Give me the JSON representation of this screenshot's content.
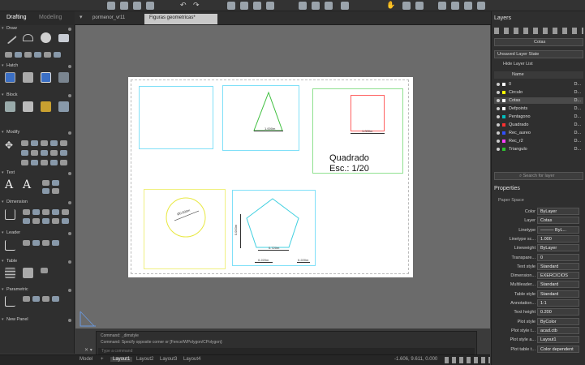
{
  "tabs": {
    "drafting": "Drafting",
    "modeling": "Modeling",
    "files": [
      "pormenor_vr11",
      "Figuras geometricas*"
    ]
  },
  "sections": [
    "Draw",
    "Hatch",
    "Block",
    "Modify",
    "Text",
    "Dimension",
    "Leader",
    "Table",
    "Parametric",
    "New Panel"
  ],
  "drawing": {
    "label1": "1.000m",
    "label2": "1.000m",
    "circle_label": "Ø0.600m",
    "pent_h": "0.000m",
    "pent_w1": "0.720m",
    "pent_w2": "0.220m",
    "pent_w3": "0.220m",
    "text_line1": "Quadrado",
    "text_line2": "Esc.: 1/20"
  },
  "command": {
    "line1": "Command: _dimstyle",
    "line2": "Command: Specify opposite corner or [Fence/WPolygon/CPolygon]:",
    "placeholder": "Type a command"
  },
  "status": {
    "model": "Model",
    "layouts": [
      "Layout1",
      "Layout2",
      "Layout3",
      "Layout4"
    ],
    "coords": "-1.606, 9.611, 0.000"
  },
  "layers": {
    "title": "Layers",
    "current": "Cotas",
    "state": "Unsaved Layer State",
    "hide_list": "Hide Layer List",
    "name_header": "Name",
    "rows": [
      {
        "name": "0",
        "color": "#ffffff",
        "d": "D..."
      },
      {
        "name": "Circulo",
        "color": "#ffff00",
        "d": "D..."
      },
      {
        "name": "Cotas",
        "color": "#ffffff",
        "d": "D...",
        "selected": true
      },
      {
        "name": "Defpoints",
        "color": "#ffffff",
        "d": "D..."
      },
      {
        "name": "Pentagono",
        "color": "#00c0c0",
        "d": "D..."
      },
      {
        "name": "Quadrado",
        "color": "#ff3030",
        "d": "D..."
      },
      {
        "name": "Rec_aureo",
        "color": "#3050ff",
        "d": "D..."
      },
      {
        "name": "Rec_r2",
        "color": "#ff40ff",
        "d": "D..."
      },
      {
        "name": "Triangulo",
        "color": "#30c030",
        "d": "D..."
      }
    ],
    "search_placeholder": "Search for layer"
  },
  "properties": {
    "title": "Properties",
    "paper_space": "Paper Space",
    "rows": [
      {
        "label": "Color",
        "value": "ByLayer"
      },
      {
        "label": "Layer",
        "value": "Cotas"
      },
      {
        "label": "Linetype",
        "value": "——— ByL..."
      },
      {
        "label": "Linetype sc...",
        "value": "1.000"
      },
      {
        "label": "Lineweight",
        "value": "ByLayer"
      },
      {
        "label": "Transpare...",
        "value": "0"
      },
      {
        "label": "Text style",
        "value": "Standard"
      },
      {
        "label": "Dimension...",
        "value": "EXERCICIOS"
      },
      {
        "label": "Multileader...",
        "value": "Standard"
      },
      {
        "label": "Table style",
        "value": "Standard"
      },
      {
        "label": "Annotation...",
        "value": "1:1"
      },
      {
        "label": "Text height",
        "value": "0.200"
      },
      {
        "label": "Plot style",
        "value": "ByColor"
      },
      {
        "label": "Plot style t...",
        "value": "acad.ctb"
      },
      {
        "label": "Plot style a...",
        "value": "Layout1"
      },
      {
        "label": "Plot table t...",
        "value": "Color dependent"
      }
    ]
  },
  "colors": {
    "frame_cyan": "#7fe0ff",
    "frame_green": "#8fe08f",
    "frame_yellow": "#f0f080",
    "quad_red": "#ff6060",
    "tri_green": "#40c040",
    "circle_yellow": "#e8e840",
    "pent_cyan": "#40d0e0"
  }
}
